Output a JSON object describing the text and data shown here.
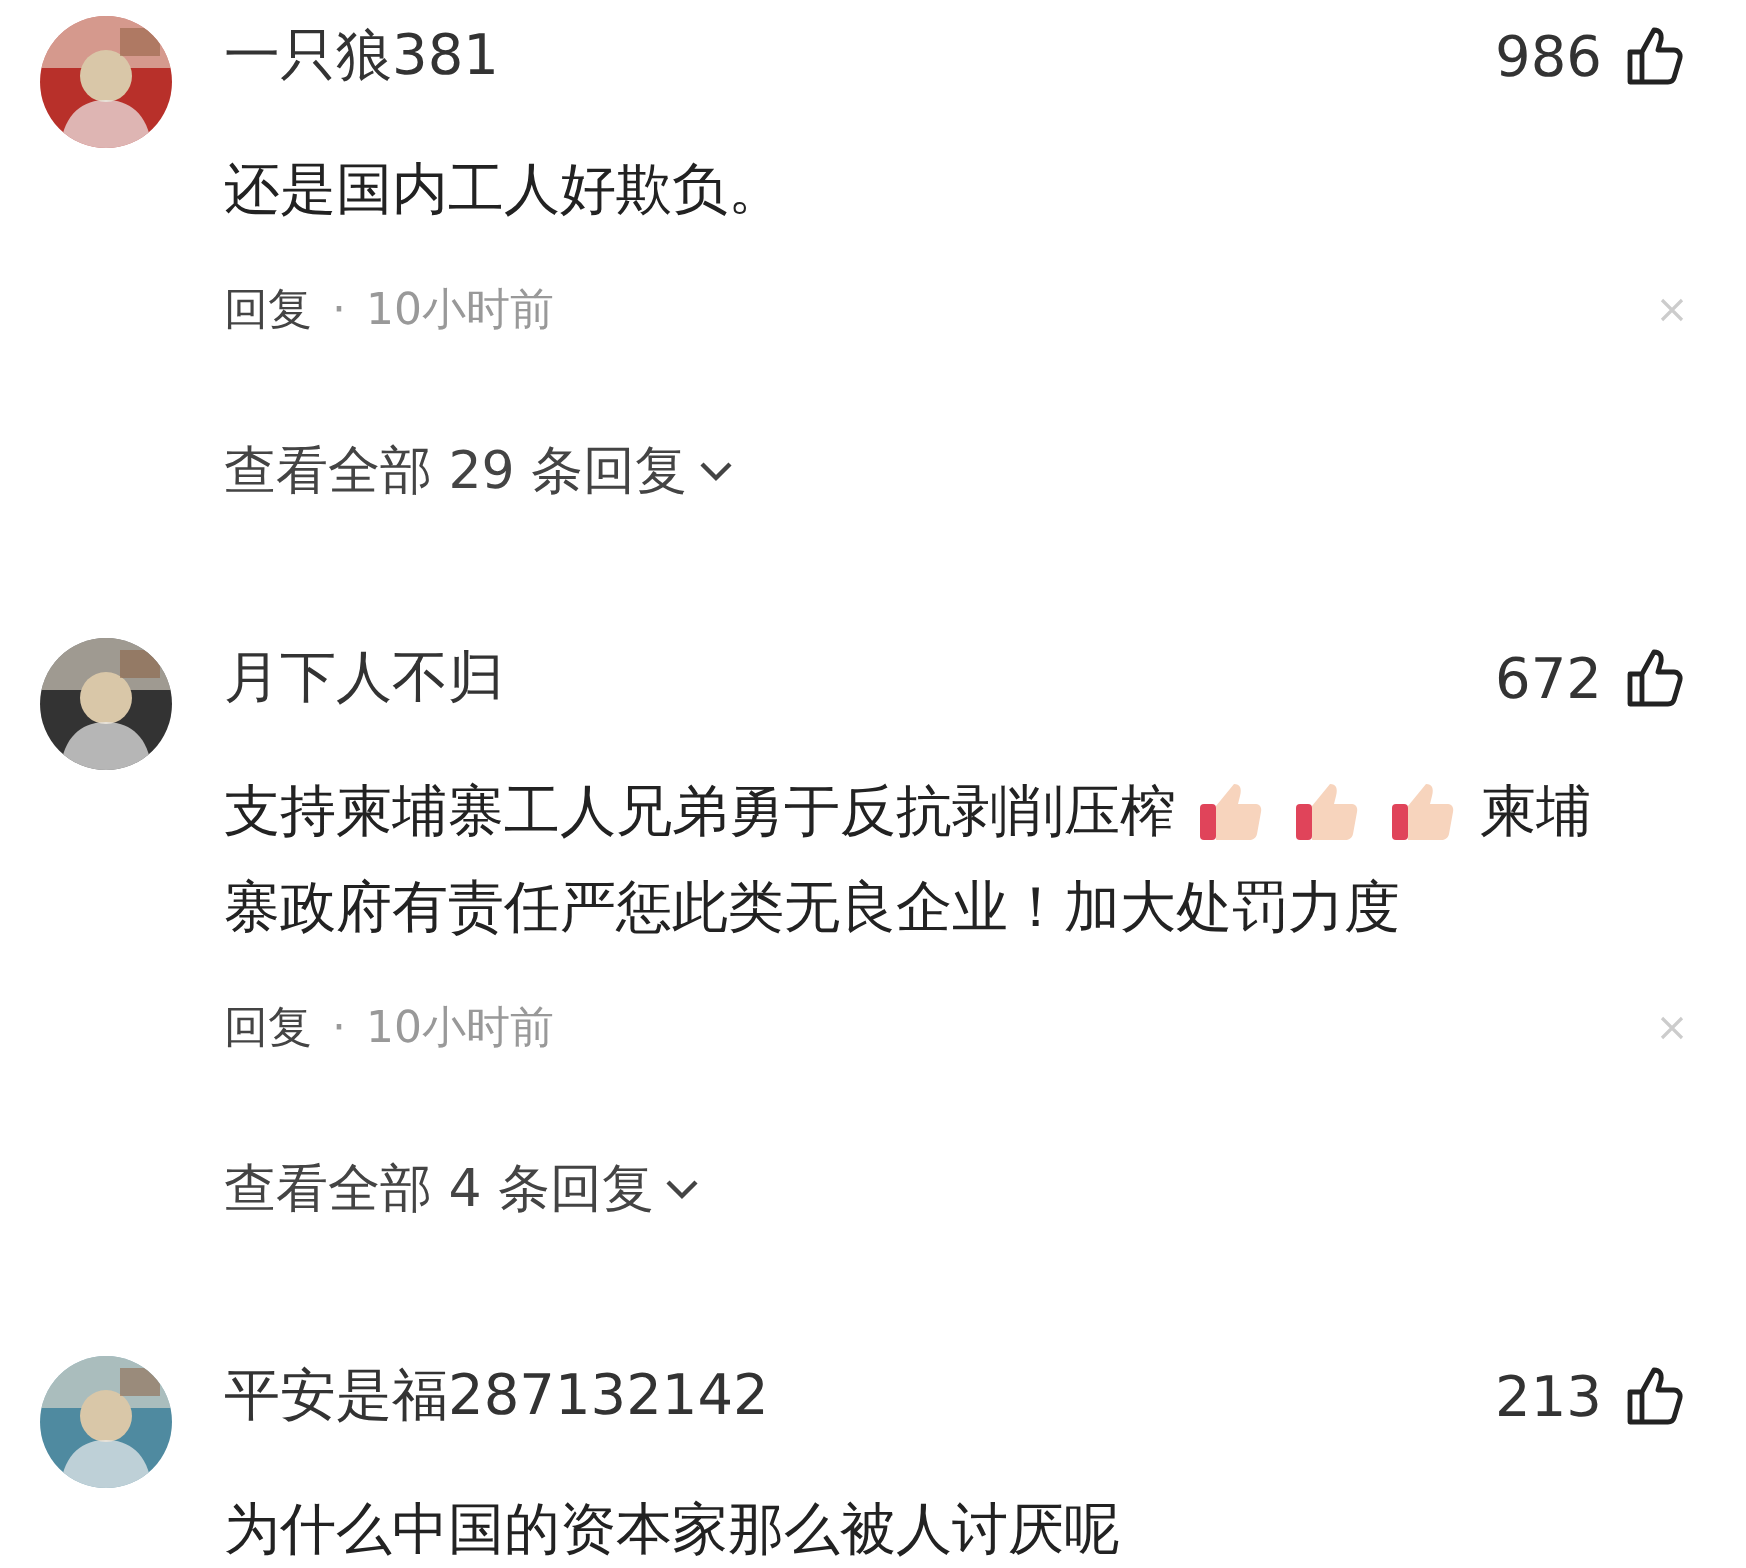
{
  "comments": [
    {
      "user": "一只狼381",
      "likes": "986",
      "body": [
        {
          "kind": "text",
          "text": "还是国内工人好欺负。"
        }
      ],
      "reply_label": "回复",
      "separator": "·",
      "time": "10小时前",
      "more": "查看全部 29 条回复"
    },
    {
      "user": "月下人不归",
      "likes": "672",
      "body": [
        {
          "kind": "text",
          "text": "支持柬埔寨工人兄弟勇于反抗剥削压榨"
        },
        {
          "kind": "emoji"
        },
        {
          "kind": "emoji"
        },
        {
          "kind": "emoji"
        },
        {
          "kind": "text",
          "text": "柬埔"
        },
        {
          "kind": "text",
          "text": "寨政府有责任严惩此类无良企业！加大处罚力度"
        }
      ],
      "reply_label": "回复",
      "separator": "·",
      "time": "10小时前",
      "more": "查看全部 4 条回复"
    },
    {
      "user": "平安是福287132142",
      "likes": "213",
      "body": [
        {
          "kind": "text",
          "text": "为什么中国的资本家那么被人讨厌呢"
        }
      ]
    }
  ]
}
